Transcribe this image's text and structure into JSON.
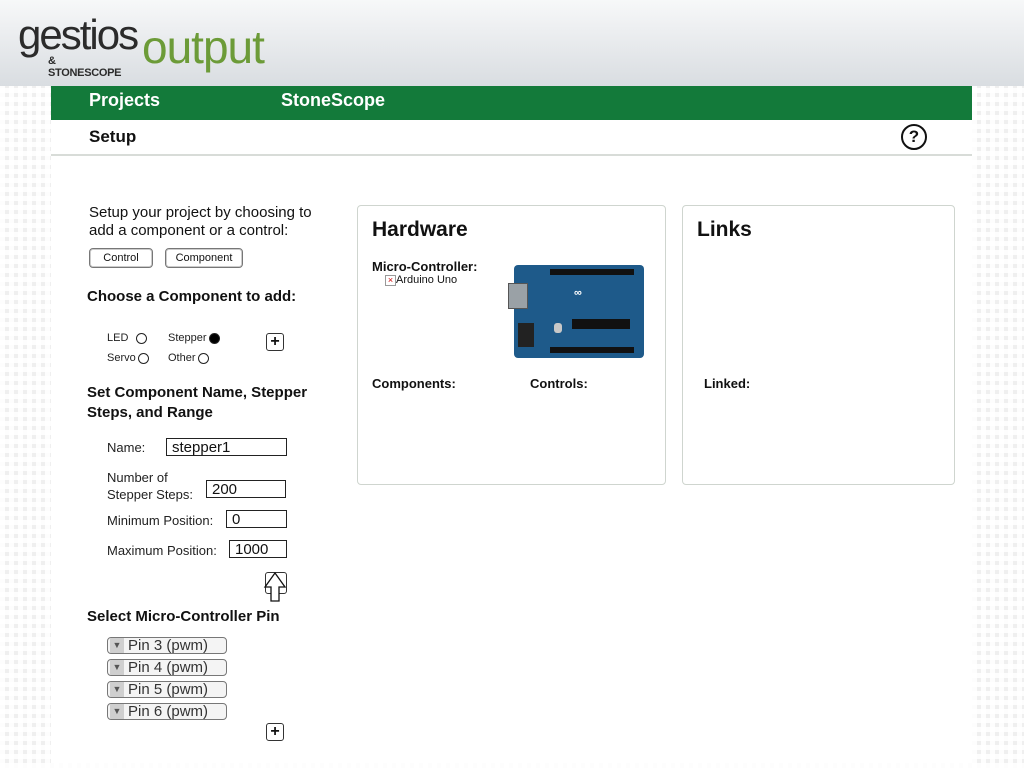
{
  "brand": {
    "logo_main": "gestios",
    "logo_sub": "& STONESCOPE",
    "logo_suffix": "output",
    "accent_color": "#137a3a",
    "logo_green": "#6c9b38"
  },
  "nav": {
    "items": [
      {
        "label": "Projects"
      },
      {
        "label": "StoneScope"
      }
    ]
  },
  "subbar": {
    "title": "Setup",
    "help_icon": "?"
  },
  "left": {
    "intro": "Setup your project by choosing to add a component or a control:",
    "control_button": "Control",
    "component_button": "Component",
    "choose_title": "Choose a Component to add:",
    "radios": [
      {
        "label": "LED",
        "selected": false
      },
      {
        "label": "Stepper",
        "selected": true
      },
      {
        "label": "Servo",
        "selected": false
      },
      {
        "label": "Other",
        "selected": false
      }
    ],
    "plus_icon": "+",
    "set_title": "Set Component Name, Stepper Steps, and Range",
    "name_label": "Name:",
    "name_value": "stepper1",
    "steps_label_1": "Number of",
    "steps_label_2": "Stepper Steps:",
    "steps_value": "200",
    "min_label": "Minimum Position:",
    "min_value": "0",
    "max_label": "Maximum Position:",
    "max_value": "1000",
    "pin_title": "Select Micro-Controller Pin",
    "pins": [
      {
        "label": "Pin 3 (pwm)"
      },
      {
        "label": "Pin 4 (pwm)"
      },
      {
        "label": "Pin 5 (pwm)"
      },
      {
        "label": "Pin 6 (pwm)"
      }
    ]
  },
  "hardware": {
    "title": "Hardware",
    "micro_label": "Micro-Controller:",
    "board_name": "Arduino Uno",
    "components_label": "Components:",
    "controls_label": "Controls:"
  },
  "links": {
    "title": "Links",
    "linked_label": "Linked:"
  }
}
